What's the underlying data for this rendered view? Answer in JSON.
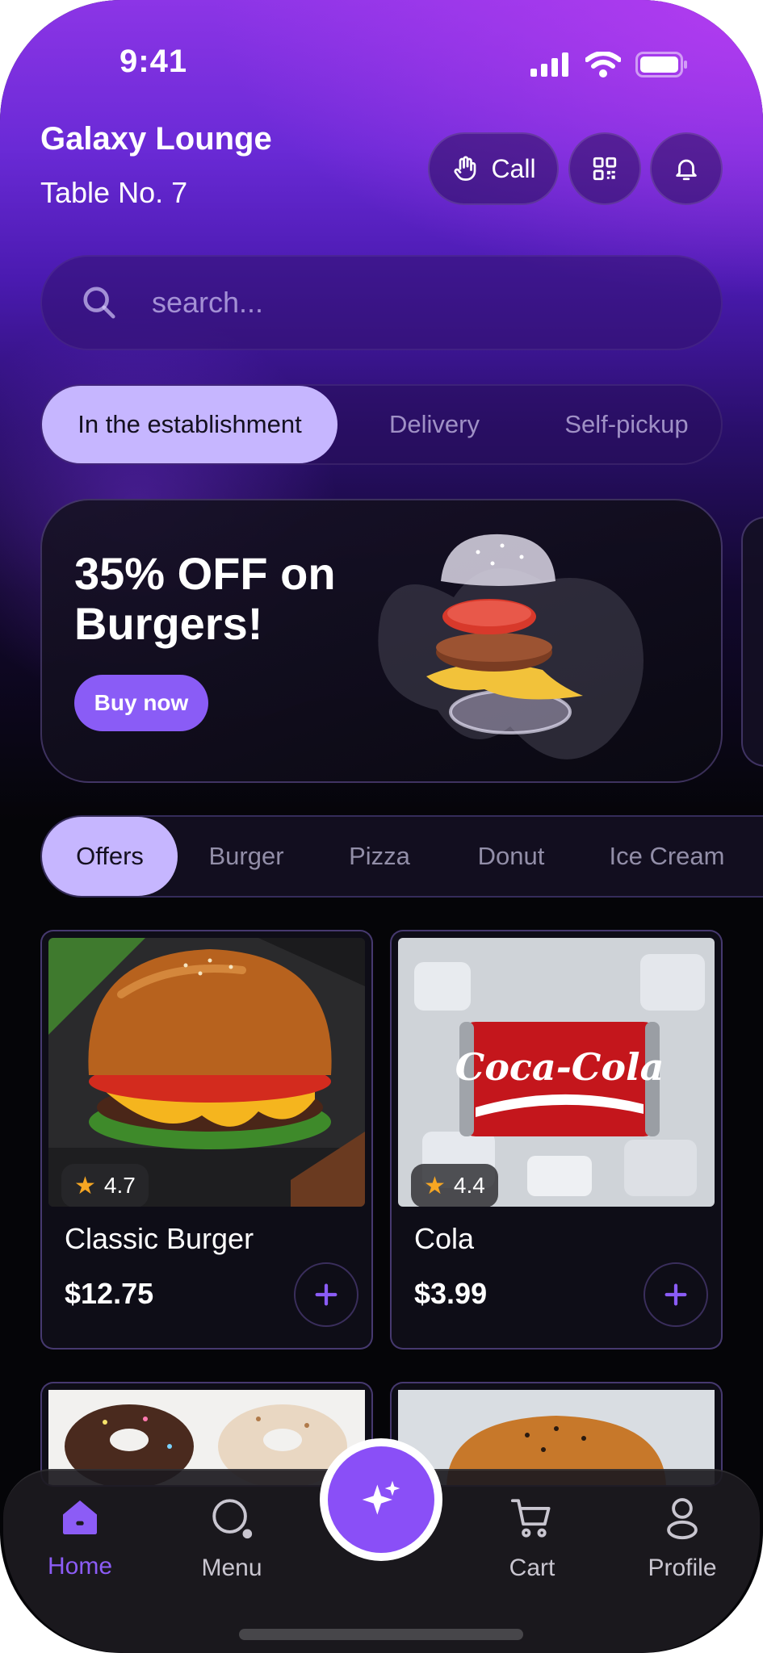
{
  "status_bar": {
    "time": "9:41"
  },
  "header": {
    "venue_name": "Galaxy Lounge",
    "table_label": "Table No. 7",
    "call_label": "Call"
  },
  "search": {
    "placeholder": "search..."
  },
  "service_modes": [
    "In the establishment",
    "Delivery",
    "Self-pickup"
  ],
  "promo": {
    "title": "35% OFF on Burgers!",
    "button_label": "Buy now"
  },
  "categories": [
    "Offers",
    "Burger",
    "Pizza",
    "Donut",
    "Ice Cream"
  ],
  "products": [
    {
      "name": "Classic Burger",
      "price": "$12.75",
      "rating": "4.7"
    },
    {
      "name": "Cola",
      "price": "$3.99",
      "rating": "4.4"
    }
  ],
  "bottom_nav": {
    "home": "Home",
    "menu": "Menu",
    "cart": "Cart",
    "profile": "Profile"
  },
  "colors": {
    "accent": "#8a5cf6",
    "active_pill": "#c6b6ff",
    "background": "#050508"
  }
}
